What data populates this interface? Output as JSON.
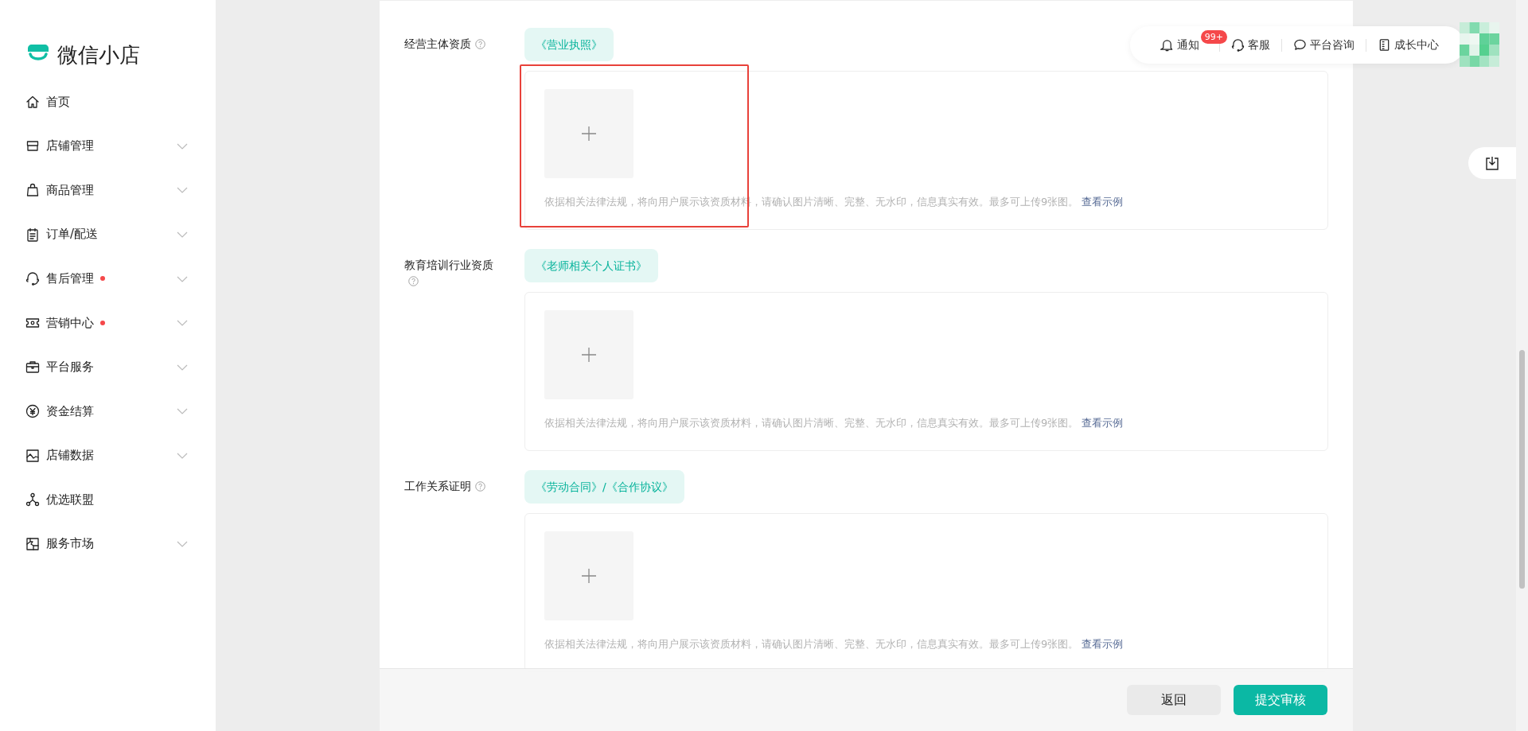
{
  "brand": {
    "name": "微信小店"
  },
  "sidebar": {
    "items": [
      {
        "label": "首页",
        "expandable": false,
        "dot": false
      },
      {
        "label": "店铺管理",
        "expandable": true,
        "dot": false
      },
      {
        "label": "商品管理",
        "expandable": true,
        "dot": false
      },
      {
        "label": "订单/配送",
        "expandable": true,
        "dot": false
      },
      {
        "label": "售后管理",
        "expandable": true,
        "dot": true
      },
      {
        "label": "营销中心",
        "expandable": true,
        "dot": true
      },
      {
        "label": "平台服务",
        "expandable": true,
        "dot": false
      },
      {
        "label": "资金结算",
        "expandable": true,
        "dot": false
      },
      {
        "label": "店铺数据",
        "expandable": true,
        "dot": false
      },
      {
        "label": "优选联盟",
        "expandable": false,
        "dot": false
      },
      {
        "label": "服务市场",
        "expandable": true,
        "dot": false
      }
    ]
  },
  "header": {
    "items": [
      {
        "label": "通知",
        "badge": "99+"
      },
      {
        "label": "客服"
      },
      {
        "label": "平台咨询"
      },
      {
        "label": "成长中心"
      }
    ]
  },
  "sections": [
    {
      "label": "经营主体资质",
      "help": true,
      "document": "《营业执照》",
      "hint": "依据相关法律法规，将向用户展示该资质材料，请确认图片清晰、完整、无水印，信息真实有效。最多可上传9张图。",
      "link": "查看示例",
      "highlighted": true
    },
    {
      "label": "教育培训行业资质",
      "help": true,
      "document": "《老师相关个人证书》",
      "hint": "依据相关法律法规，将向用户展示该资质材料，请确认图片清晰、完整、无水印，信息真实有效。最多可上传9张图。",
      "link": "查看示例",
      "highlighted": false
    },
    {
      "label": "工作关系证明",
      "help": true,
      "document": "《劳动合同》/《合作协议》",
      "hint": "依据相关法律法规，将向用户展示该资质材料，请确认图片清晰、完整、无水印，信息真实有效。最多可上传9张图。",
      "link": "查看示例",
      "highlighted": false
    }
  ],
  "footer": {
    "buttons": [
      {
        "label": "返回",
        "primary": false
      },
      {
        "label": "提交审核",
        "primary": true
      }
    ]
  }
}
